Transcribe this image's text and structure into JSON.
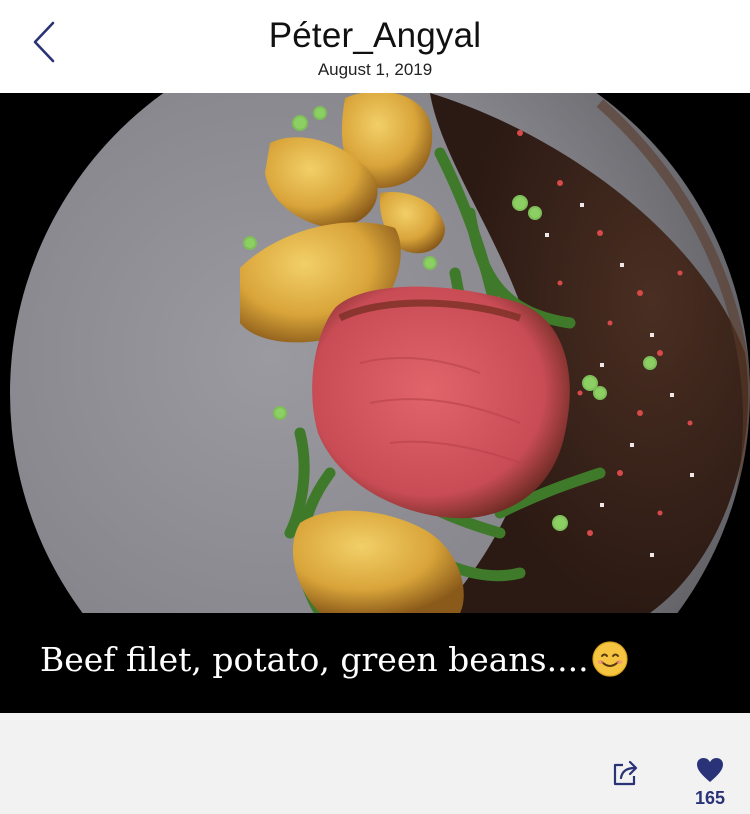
{
  "header": {
    "title": "Péter_Angyal",
    "date": "August 1, 2019"
  },
  "post": {
    "caption": "Beef filet, potato, green beans....",
    "caption_emoji": "smiling-face-emoji"
  },
  "actions": {
    "like_count": "165"
  },
  "icons": {
    "back": "chevron-left-icon",
    "share": "share-icon",
    "like": "heart-icon"
  },
  "colors": {
    "accent": "#2a3377",
    "footer_bg": "#f2f2f2",
    "caption_bg": "#000000"
  }
}
